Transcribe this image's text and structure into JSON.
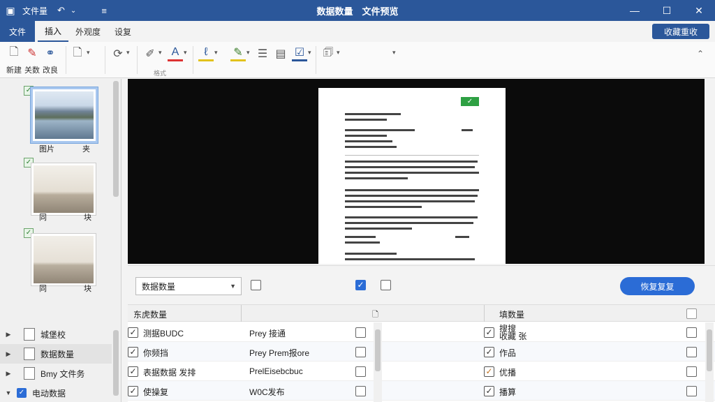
{
  "titlebar": {
    "app_name": "文件量",
    "title": "数据数量　文件预览",
    "icons": [
      "save-icon",
      "undo-icon",
      "redo-icon",
      "menu-icon"
    ]
  },
  "tabs": {
    "file": "文件",
    "items": [
      "插入",
      "外观度",
      "设复"
    ],
    "active_index": 0,
    "share_label": "收藏重收"
  },
  "ribbon": {
    "buttons": [
      {
        "label": "新建",
        "icon": "new-doc-icon"
      },
      {
        "label": "关数",
        "icon": "edit-icon"
      },
      {
        "label": "改良",
        "icon": "link-icon"
      }
    ],
    "group_label": "格式"
  },
  "thumbnails": [
    {
      "caption_left": "图片",
      "caption_right": "夹"
    },
    {
      "caption_left": "同",
      "caption_right": "块"
    },
    {
      "caption_left": "同",
      "caption_right": "块"
    }
  ],
  "preview": {
    "status": "✓"
  },
  "filterbar": {
    "dropdown_value": "数据数量",
    "checkbox1_checked": false,
    "checkbox2_checked": true,
    "checkbox3_checked": false,
    "primary_label": "恢复复复"
  },
  "table": {
    "headers": {
      "col1": "东虎数量",
      "col3": "填数量"
    },
    "rows": [
      {
        "left_name": "测据BUDC",
        "left_value": "Prey 接通",
        "right_name": "搜搜",
        "right_value": "收藏 张"
      },
      {
        "left_name": "你频挡",
        "left_value": "Prey Prem报ore",
        "right_name": "",
        "right_value": "作品"
      },
      {
        "left_name": "表据数据 发排",
        "left_value": "PrelEisebcbuc",
        "right_name": "",
        "right_value": "优播"
      },
      {
        "left_name": "使操复",
        "left_value": "W0C发布",
        "right_name": "",
        "right_value": "播算"
      }
    ]
  },
  "tree": [
    {
      "label": "城堡校",
      "type": "doc"
    },
    {
      "label": "数据数量",
      "type": "doc",
      "selected": true
    },
    {
      "label": "Bmy 文件务",
      "type": "doc"
    },
    {
      "label": "电动数据",
      "type": "check"
    }
  ]
}
